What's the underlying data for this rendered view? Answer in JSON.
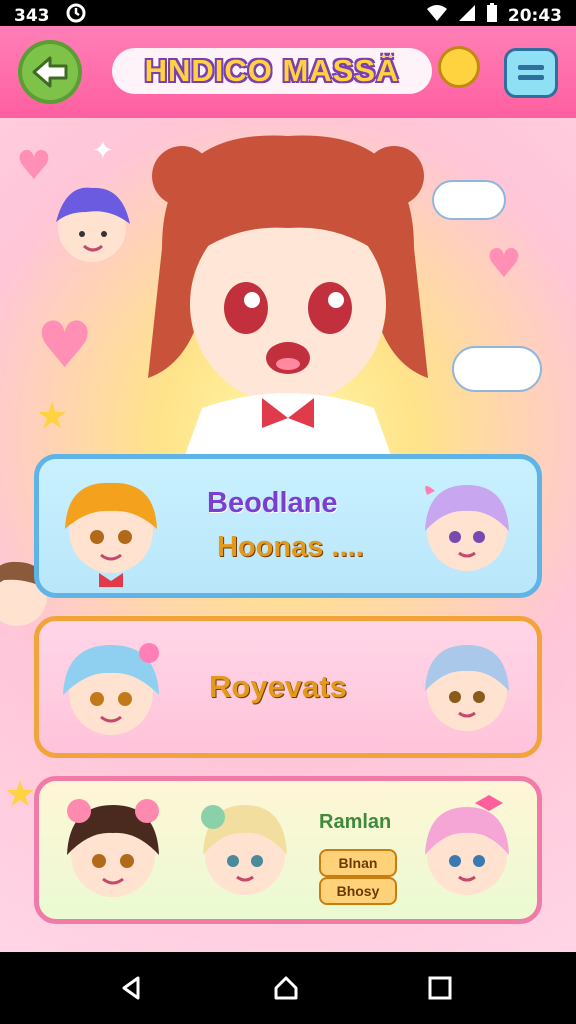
{
  "status_bar": {
    "left_text": "343",
    "time": "20:43"
  },
  "app_bar": {
    "title": "HNDICO MASSÄ"
  },
  "cards": [
    {
      "line1": "Beodlane",
      "line2": "Hoonas ...."
    },
    {
      "label": "Royevats"
    },
    {
      "label": "Ramlan",
      "pill1": "Blnan",
      "pill2": "Bhosy"
    }
  ],
  "colors": {
    "app_bar": "#ff5fa0",
    "card1_border": "#5fb3e6",
    "card2_border": "#f2a33a",
    "card3_border": "#f07aa8"
  }
}
